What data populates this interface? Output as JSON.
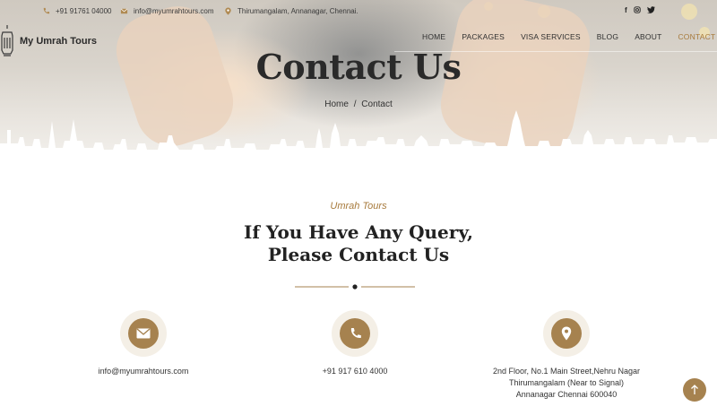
{
  "topbar": {
    "phone": "+91 91761 04000",
    "email": "info@myumrahtours.com",
    "location": "Thirumangalam, Annanagar, Chennai.",
    "social": [
      "f",
      "ig",
      "tw"
    ]
  },
  "brand": {
    "name": "My Umrah Tours"
  },
  "nav": {
    "items": [
      "HOME",
      "PACKAGES",
      "VISA SERVICES",
      "BLOG",
      "ABOUT",
      "CONTACT"
    ],
    "active": "CONTACT"
  },
  "hero": {
    "title": "Contact Us",
    "breadcrumb_home": "Home",
    "breadcrumb_sep": "/",
    "breadcrumb_current": "Contact"
  },
  "section": {
    "eyebrow": "Umrah Tours",
    "heading_line1": "If You Have Any Query,",
    "heading_line2": "Please Contact Us"
  },
  "contacts": {
    "email": "info@myumrahtours.com",
    "phone": "+91 917 610 4000",
    "address_line1": "2nd Floor, No.1 Main Street,Nehru Nagar",
    "address_line2": "Thirumangalam (Near to Signal)",
    "address_line3": "Annanagar Chennai 600040"
  },
  "colors": {
    "accent": "#a6824f",
    "accent_text": "#a77a3c",
    "dark": "#222222"
  },
  "icons": [
    "phone-icon",
    "mail-icon",
    "location-pin-icon",
    "facebook-icon",
    "instagram-icon",
    "twitter-icon",
    "lantern-logo-icon",
    "envelope-icon",
    "arrow-up-icon"
  ]
}
